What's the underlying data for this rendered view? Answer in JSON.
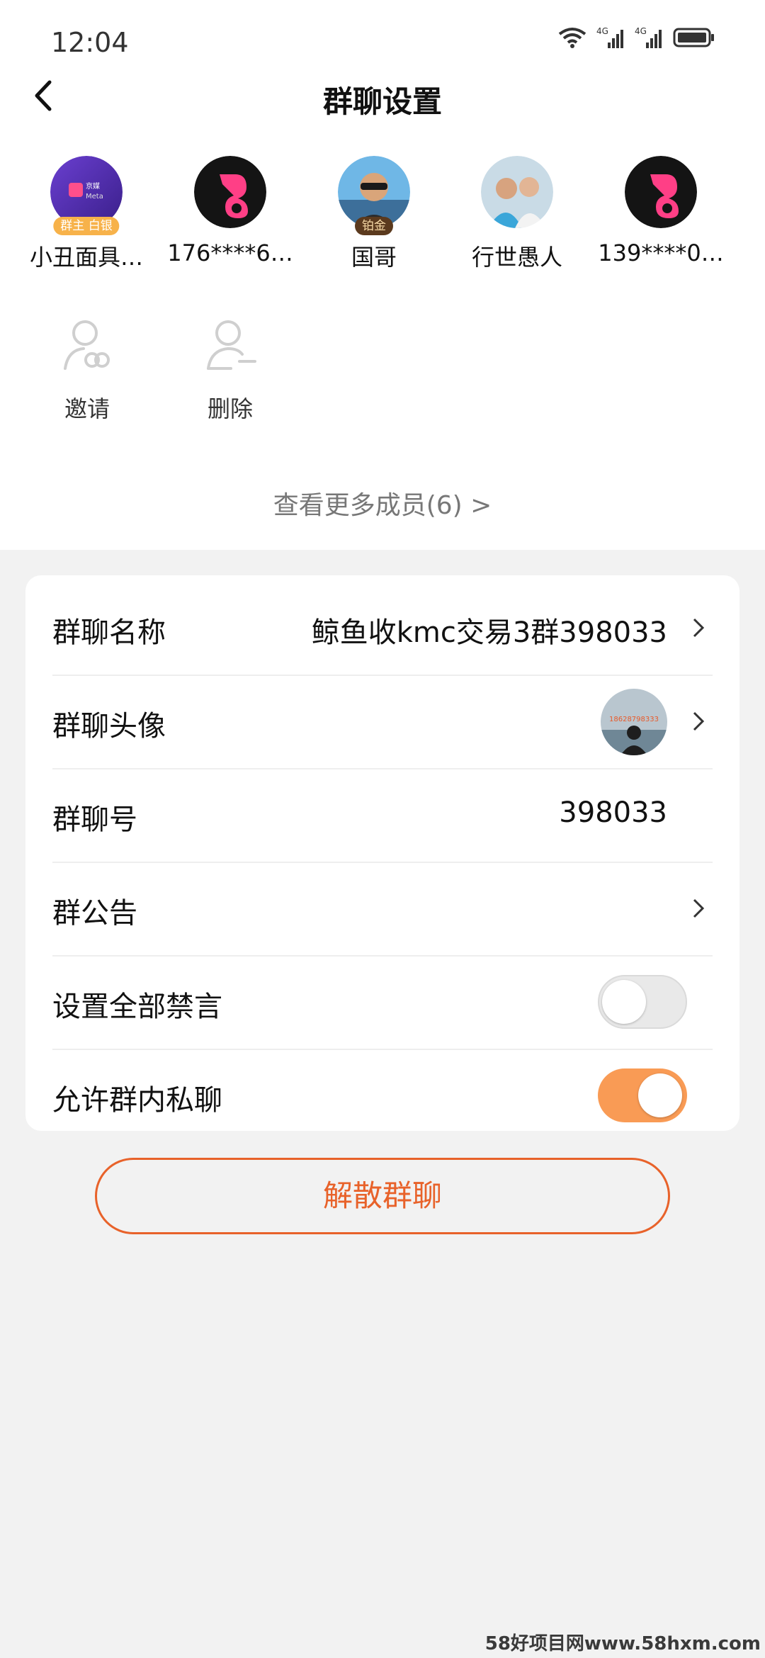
{
  "status_bar": {
    "time": "12:04"
  },
  "header": {
    "title": "群聊设置"
  },
  "members": [
    {
      "name": "小丑面具…",
      "avatar": "meta-logo-avatar",
      "badge": "白银",
      "owner_tag": "群主"
    },
    {
      "name": "176****6…",
      "avatar": "pink-logo-avatar"
    },
    {
      "name": "国哥",
      "avatar": "photo-avatar",
      "badge": "铂金"
    },
    {
      "name": "行世愚人",
      "avatar": "photo-avatar"
    },
    {
      "name": "139****0…",
      "avatar": "pink-logo-avatar"
    }
  ],
  "avatar_text": {
    "meta_brand": "京媒",
    "meta_sub": "Meta",
    "group_photo_text": "18628798333"
  },
  "actions": {
    "invite": "邀请",
    "delete": "删除"
  },
  "see_more": "查看更多成员(6) >",
  "settings": {
    "group_name_label": "群聊名称",
    "group_name_value": "鲸鱼收kmc交易3群398033",
    "group_avatar_label": "群聊头像",
    "group_id_label": "群聊号",
    "group_id_value": "398033",
    "announcement_label": "群公告",
    "mute_all_label": "设置全部禁言",
    "mute_all_on": false,
    "allow_private_label": "允许群内私聊",
    "allow_private_on": true
  },
  "dissolve_button": "解散群聊",
  "watermark": "58好项目网www.58hxm.com",
  "colors": {
    "accent": "#e8622a",
    "toggle_on": "#f99b55",
    "background": "#f2f2f2"
  }
}
